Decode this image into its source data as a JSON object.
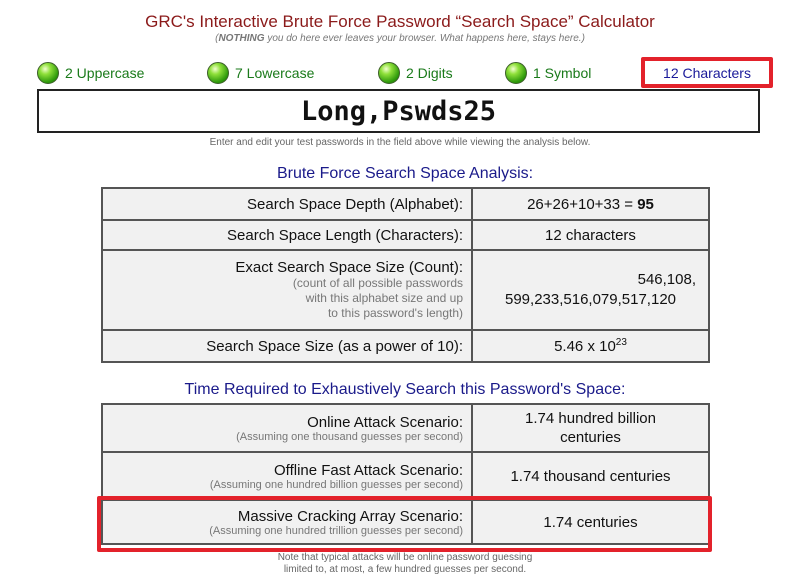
{
  "header": {
    "title": "GRC's Interactive Brute Force Password “Search Space” Calculator",
    "subtitle_strong": "NOTHING",
    "subtitle_rest": " you do here ever leaves your browser. What happens here, stays here.)",
    "subtitle_open": "("
  },
  "stats": {
    "uppercase": "2 Uppercase",
    "lowercase": "7 Lowercase",
    "digits": "2 Digits",
    "symbols": "1 Symbol",
    "characters": "12 Characters",
    "indicator_color": "#2f9a0c"
  },
  "password": {
    "value": "Long,Pswds25"
  },
  "hint": "Enter and edit your test passwords in the field above while viewing the analysis below.",
  "analysis": {
    "title": "Brute Force Search Space Analysis:",
    "depth_label": "Search Space Depth (Alphabet):",
    "depth_formula": "26+26+10+33 = ",
    "depth_total": "95",
    "length_label": "Search Space Length (Characters):",
    "length_value": "12 characters",
    "size_label": "Exact Search Space Size (Count):",
    "size_note_1": "(count of all possible passwords",
    "size_note_2": "with this alphabet size and up",
    "size_note_3": "to this password's length)",
    "size_value_1": "546,108,",
    "size_value_2": "599,233,516,079,517,120",
    "power_label": "Search Space Size (as a power of 10):",
    "power_mantissa": "5.46 x 10",
    "power_exponent": "23"
  },
  "time": {
    "title": "Time Required to Exhaustively Search this Password's Space:",
    "online_label": "Online Attack Scenario:",
    "online_note": "(Assuming one thousand guesses per second)",
    "online_value_1": "1.74 hundred billion",
    "online_value_2": "centuries",
    "offline_label": "Offline Fast Attack Scenario:",
    "offline_note": "(Assuming one hundred billion guesses per second)",
    "offline_value": "1.74 thousand centuries",
    "massive_label": "Massive Cracking Array Scenario:",
    "massive_note": "(Assuming one hundred trillion guesses per second)",
    "massive_value": "1.74 centuries"
  },
  "note": {
    "line1": "Note that typical attacks will be online password guessing",
    "line2": "limited to, at most, a few hundred guesses per second."
  },
  "colors": {
    "title": "#8b1a1a",
    "section_title": "#1a1a8a",
    "highlight": "#e3222b",
    "stat_text": "#1a7a1a"
  }
}
